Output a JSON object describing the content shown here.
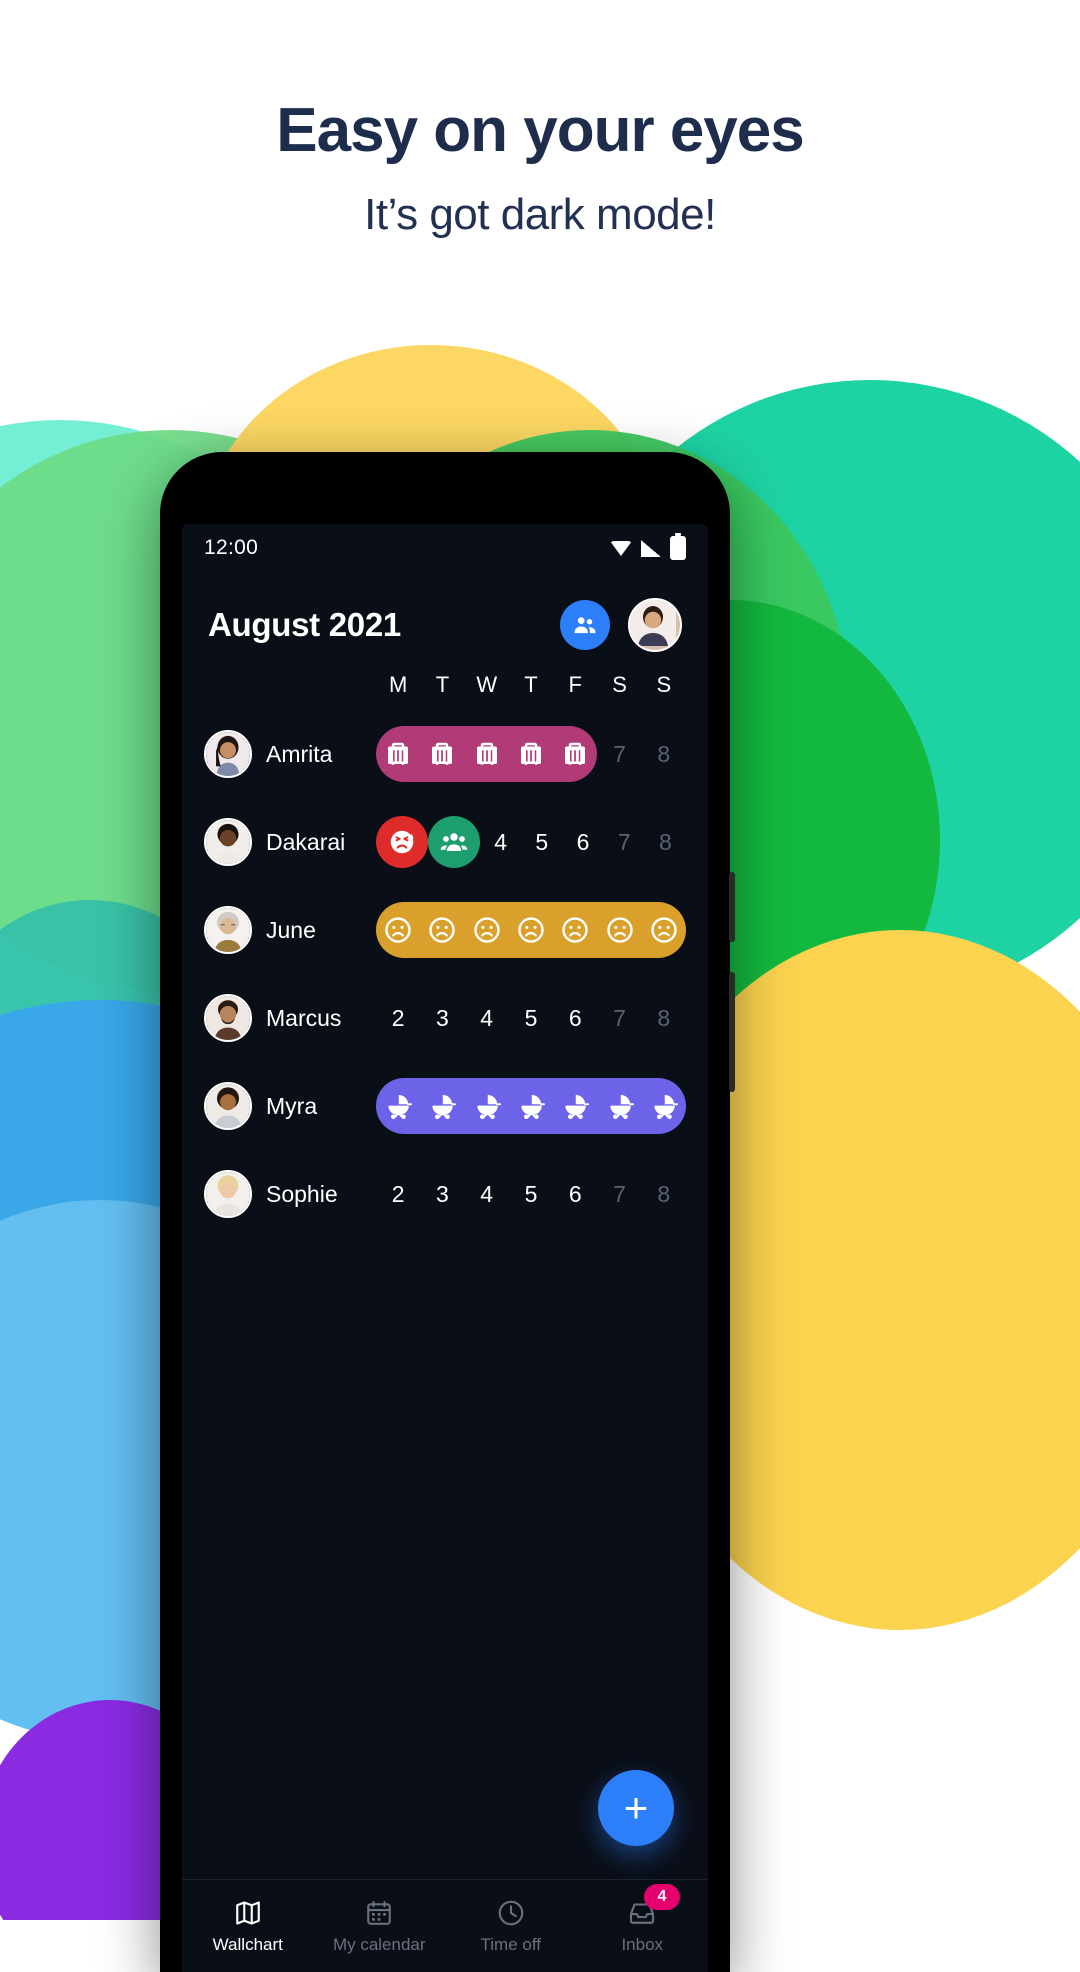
{
  "promo": {
    "title": "Easy on your eyes",
    "subtitle": "It’s got dark mode!",
    "title_color": "#1f2d4d"
  },
  "phone": {
    "status_bar": {
      "time": "12:00",
      "icons": [
        "wifi-icon",
        "signal-icon",
        "battery-icon"
      ]
    },
    "app_header": {
      "month_title": "August 2021",
      "team_button_label": "",
      "team_icon": "people-icon",
      "avatar_label": ""
    },
    "weekdays": [
      "M",
      "T",
      "W",
      "T",
      "F",
      "S",
      "S"
    ],
    "rows": [
      {
        "name": "Amrita",
        "avatar": "avatar-amrita",
        "pill": {
          "color": "#B13B77",
          "start": 0,
          "span": 5
        },
        "cells": [
          {
            "type": "icon",
            "icon": "suitcase-icon"
          },
          {
            "type": "icon",
            "icon": "suitcase-icon"
          },
          {
            "type": "icon",
            "icon": "suitcase-icon"
          },
          {
            "type": "icon",
            "icon": "suitcase-icon"
          },
          {
            "type": "icon",
            "icon": "suitcase-icon"
          },
          {
            "type": "number",
            "value": "7",
            "muted": true
          },
          {
            "type": "number",
            "value": "8",
            "muted": true
          }
        ]
      },
      {
        "name": "Dakarai",
        "avatar": "avatar-dakarai",
        "cells": [
          {
            "type": "badge",
            "icon": "sick-face-icon",
            "color": "#E02B2B"
          },
          {
            "type": "badge",
            "icon": "people-icon",
            "color": "#1D9E6E"
          },
          {
            "type": "number",
            "value": "4",
            "muted": false
          },
          {
            "type": "number",
            "value": "5",
            "muted": false
          },
          {
            "type": "number",
            "value": "6",
            "muted": false
          },
          {
            "type": "number",
            "value": "7",
            "muted": true
          },
          {
            "type": "number",
            "value": "8",
            "muted": true
          }
        ]
      },
      {
        "name": "June",
        "avatar": "avatar-june",
        "pill": {
          "color": "#D9A02B",
          "start": 0,
          "span": 7
        },
        "cells": [
          {
            "type": "icon",
            "icon": "sad-face-icon"
          },
          {
            "type": "icon",
            "icon": "sad-face-icon"
          },
          {
            "type": "icon",
            "icon": "sad-face-icon"
          },
          {
            "type": "icon",
            "icon": "sad-face-icon"
          },
          {
            "type": "icon",
            "icon": "sad-face-icon"
          },
          {
            "type": "icon",
            "icon": "sad-face-icon"
          },
          {
            "type": "icon",
            "icon": "sad-face-icon"
          }
        ]
      },
      {
        "name": "Marcus",
        "avatar": "avatar-marcus",
        "cells": [
          {
            "type": "number",
            "value": "2",
            "muted": false
          },
          {
            "type": "number",
            "value": "3",
            "muted": false
          },
          {
            "type": "number",
            "value": "4",
            "muted": false
          },
          {
            "type": "number",
            "value": "5",
            "muted": false
          },
          {
            "type": "number",
            "value": "6",
            "muted": false
          },
          {
            "type": "number",
            "value": "7",
            "muted": true
          },
          {
            "type": "number",
            "value": "8",
            "muted": true
          }
        ]
      },
      {
        "name": "Myra",
        "avatar": "avatar-myra",
        "pill": {
          "color": "#6C63E8",
          "start": 0,
          "span": 7
        },
        "cells": [
          {
            "type": "icon",
            "icon": "stroller-icon"
          },
          {
            "type": "icon",
            "icon": "stroller-icon"
          },
          {
            "type": "icon",
            "icon": "stroller-icon"
          },
          {
            "type": "icon",
            "icon": "stroller-icon"
          },
          {
            "type": "icon",
            "icon": "stroller-icon"
          },
          {
            "type": "icon",
            "icon": "stroller-icon"
          },
          {
            "type": "icon",
            "icon": "stroller-icon"
          }
        ]
      },
      {
        "name": "Sophie",
        "avatar": "avatar-sophie",
        "cells": [
          {
            "type": "number",
            "value": "2",
            "muted": false
          },
          {
            "type": "number",
            "value": "3",
            "muted": false
          },
          {
            "type": "number",
            "value": "4",
            "muted": false
          },
          {
            "type": "number",
            "value": "5",
            "muted": false
          },
          {
            "type": "number",
            "value": "6",
            "muted": false
          },
          {
            "type": "number",
            "value": "7",
            "muted": true
          },
          {
            "type": "number",
            "value": "8",
            "muted": true
          }
        ]
      }
    ],
    "fab": {
      "label": "+",
      "color": "#2D7FF9"
    },
    "bottom_nav": [
      {
        "label": "Wallchart",
        "icon": "map-icon",
        "active": true,
        "badge": null
      },
      {
        "label": "My calendar",
        "icon": "calendar-icon",
        "active": false,
        "badge": null
      },
      {
        "label": "Time off",
        "icon": "clock-icon",
        "active": false,
        "badge": null
      },
      {
        "label": "Inbox",
        "icon": "inbox-icon",
        "active": false,
        "badge": "4"
      }
    ]
  }
}
